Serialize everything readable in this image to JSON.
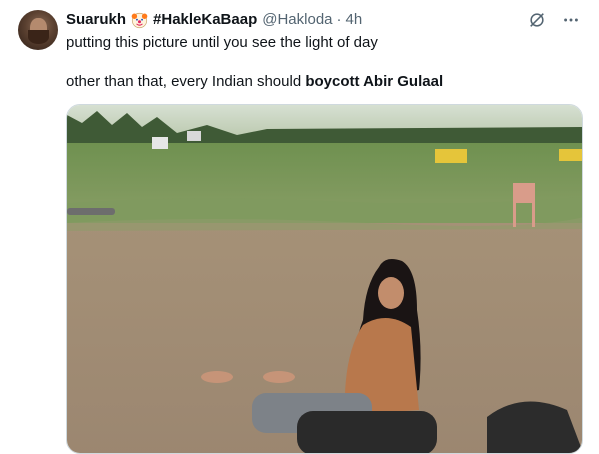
{
  "tweet": {
    "author_name": "Suarukh",
    "author_emoji": "clown-face-emoji",
    "author_hashtag": "#HakleKaBaap",
    "handle": "@Hakloda",
    "separator": "·",
    "time": "4h",
    "line1": "putting this picture until you see the light of day",
    "line2_prefix": "other than that, every Indian should ",
    "line2_bold": "boycott Abir Gulaal"
  },
  "icons": {
    "grok": "grok-icon",
    "more": "more-options-icon",
    "avatar": "profile-avatar"
  },
  "colors": {
    "text": "#0f1419",
    "secondary": "#536471",
    "grass": "#6e8f52",
    "ground": "#a08a72"
  }
}
